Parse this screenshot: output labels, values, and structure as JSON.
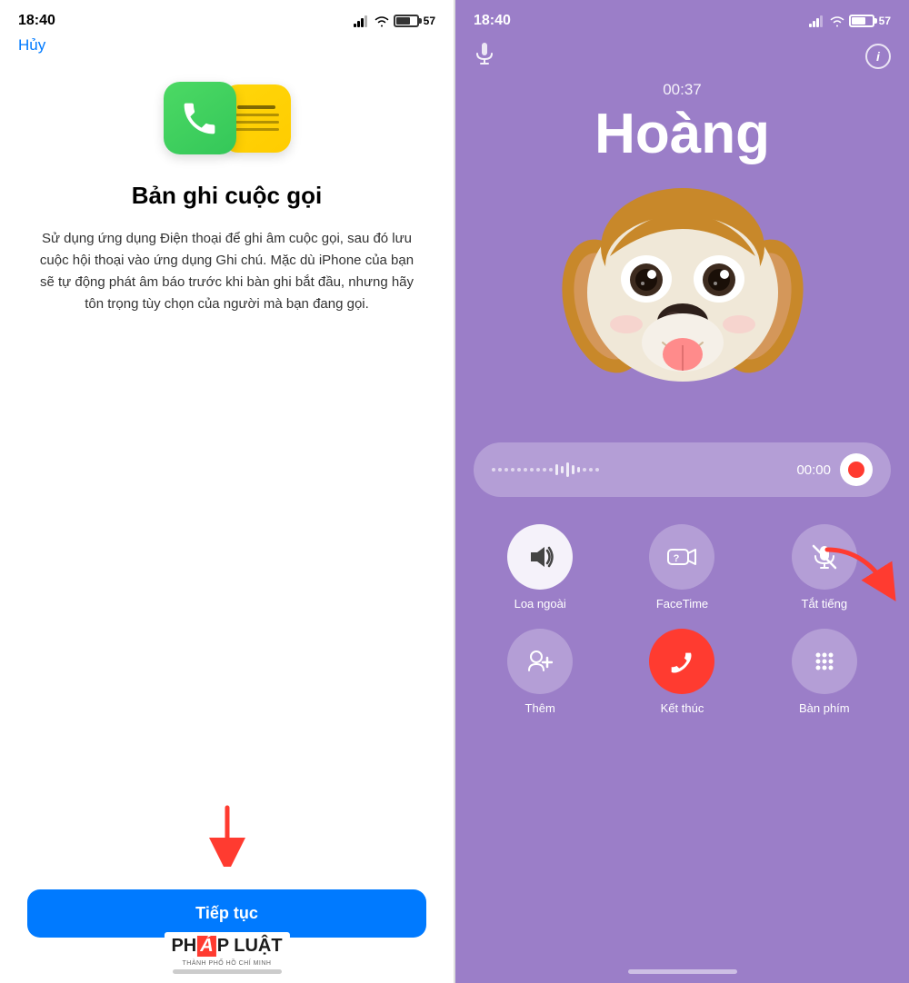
{
  "left": {
    "status_time": "18:40",
    "battery": "57",
    "cancel_btn": "Hủy",
    "title": "Bản ghi cuộc gọi",
    "description": "Sử dụng ứng dụng Điện thoại để ghi âm cuộc gọi, sau đó lưu cuộc hội thoại vào ứng dụng Ghi chú. Mặc dù iPhone của bạn sẽ tự động phát âm báo trước khi bàn ghi bắt đầu, nhưng hãy tôn trọng tùy chọn của người mà bạn đang gọi.",
    "continue_btn": "Tiếp tục"
  },
  "right": {
    "status_time": "18:40",
    "battery": "57",
    "call_duration": "00:37",
    "caller_name": "Hoàng",
    "rec_time": "00:00",
    "controls": [
      {
        "label": "Loa ngoài",
        "icon": "speaker",
        "active": true
      },
      {
        "label": "FaceTime",
        "icon": "facetime",
        "active": false
      },
      {
        "label": "Tắt tiếng",
        "icon": "mute",
        "active": false
      },
      {
        "label": "Thêm",
        "icon": "add",
        "active": false
      },
      {
        "label": "Kết thúc",
        "icon": "end",
        "active": false,
        "red": true
      },
      {
        "label": "Bàn phím",
        "icon": "keypad",
        "active": false
      }
    ]
  },
  "watermark": {
    "brand": "PHÁP LUẬT",
    "sub": "THÀNH PHỐ HỒ CHÍ MINH"
  }
}
